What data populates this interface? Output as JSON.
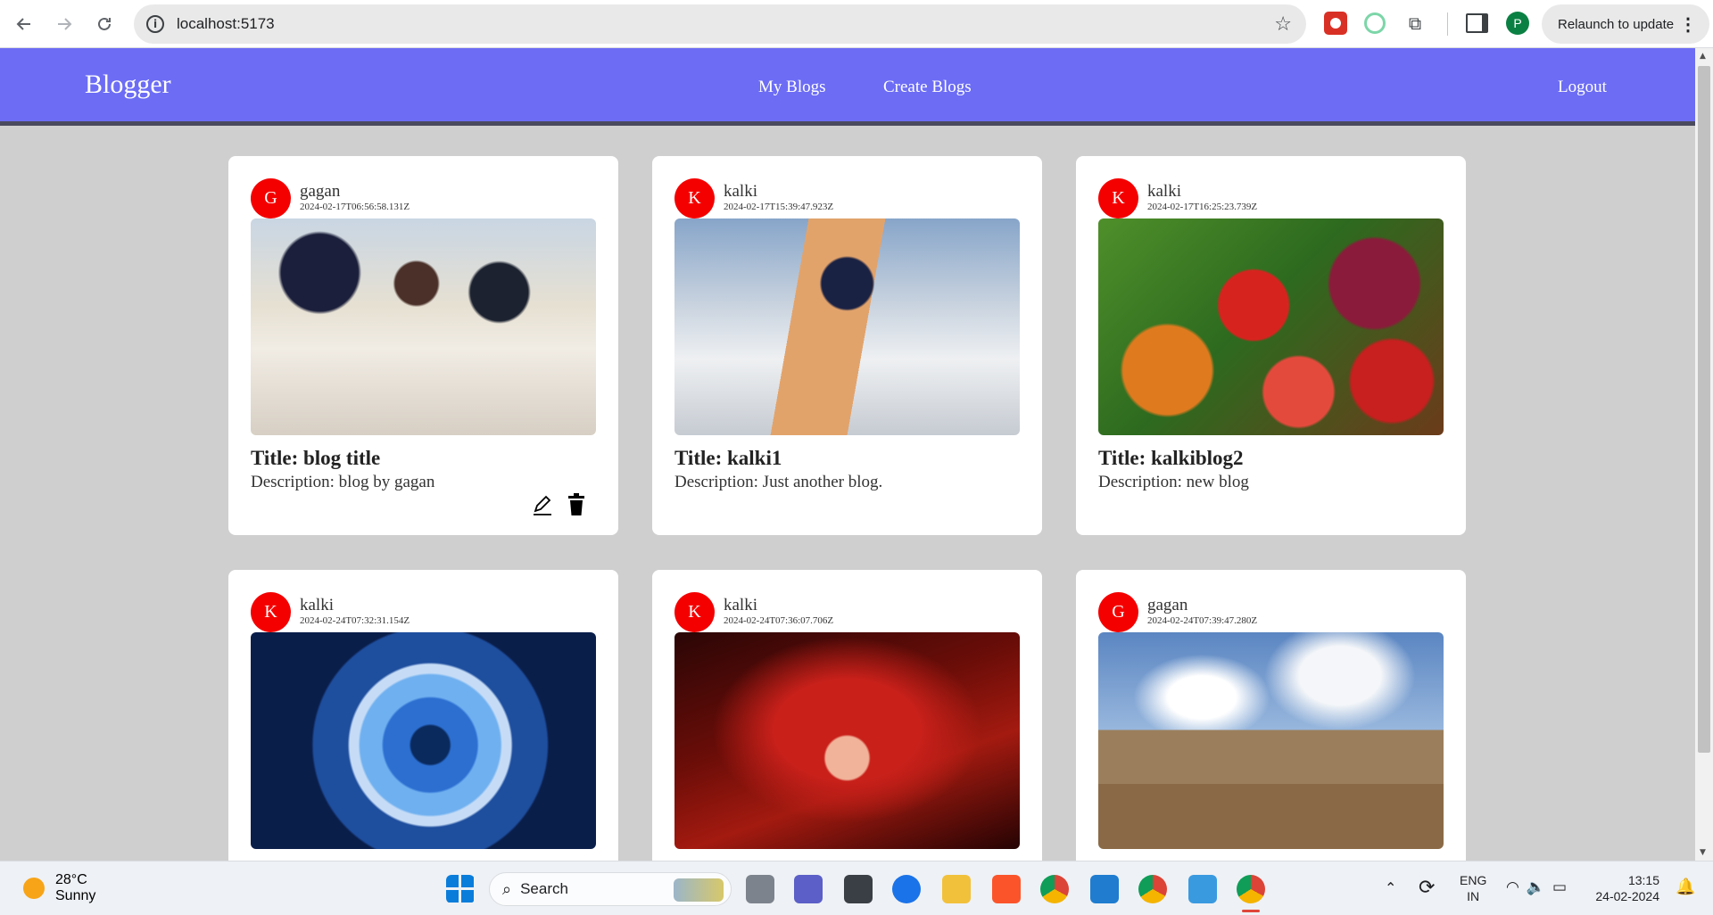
{
  "browser": {
    "url": "localhost:5173",
    "relaunch_label": "Relaunch to update",
    "profile_initial": "P"
  },
  "app": {
    "brand": "Blogger",
    "nav": {
      "my_blogs": "My Blogs",
      "create_blogs": "Create Blogs",
      "logout": "Logout"
    },
    "accent_color": "#6c6cf5",
    "avatar_color": "#f40000"
  },
  "posts": [
    {
      "initial": "G",
      "author": "gagan",
      "date": "2024-02-17T06:56:58.131Z",
      "image": "cricket-celebration-image",
      "title": "Title: blog title",
      "description": "Description: blog by gagan",
      "editable": true
    },
    {
      "initial": "K",
      "author": "kalki",
      "date": "2024-02-17T15:39:47.923Z",
      "image": "cricket-batsman-image",
      "title": "Title: kalki1",
      "description": "Description: Just another blog."
    },
    {
      "initial": "K",
      "author": "kalki",
      "date": "2024-02-17T16:25:23.739Z",
      "image": "vegetables-image",
      "title": "Title: kalkiblog2",
      "description": "Description: new blog"
    },
    {
      "initial": "K",
      "author": "kalki",
      "date": "2024-02-24T07:32:31.154Z",
      "image": "blue-eye-image"
    },
    {
      "initial": "K",
      "author": "kalki",
      "date": "2024-02-24T07:36:07.706Z",
      "image": "red-hair-anime-image"
    },
    {
      "initial": "G",
      "author": "gagan",
      "date": "2024-02-24T07:39:47.280Z",
      "image": "temple-image"
    }
  ],
  "taskbar": {
    "weather_temp": "28°C",
    "weather_desc": "Sunny",
    "search_label": "Search",
    "lang_line1": "ENG",
    "lang_line2": "IN",
    "time": "13:15",
    "date": "24-02-2024"
  }
}
